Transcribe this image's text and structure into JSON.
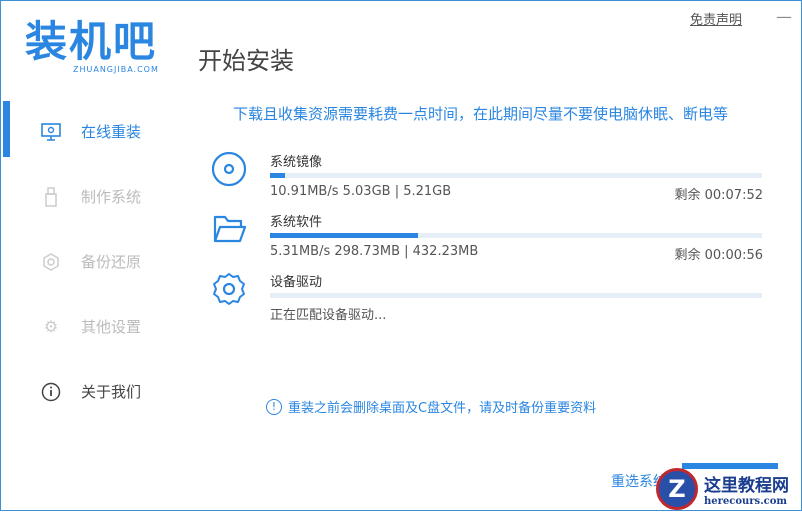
{
  "header": {
    "logo_text": "装机吧",
    "logo_sub": "ZHUANGJIBA.COM",
    "title": "开始安装",
    "disclaimer": "免责声明",
    "minimize": "—"
  },
  "sidebar": {
    "items": [
      {
        "label": "在线重装",
        "icon": "monitor-icon"
      },
      {
        "label": "制作系统",
        "icon": "usb-icon"
      },
      {
        "label": "备份还原",
        "icon": "backup-icon"
      },
      {
        "label": "其他设置",
        "icon": "gear-icon"
      },
      {
        "label": "关于我们",
        "icon": "info-icon"
      }
    ]
  },
  "main": {
    "notice": "下载且收集资源需要耗费一点时间，在此期间尽量不要使电脑休眠、断电等",
    "tasks": [
      {
        "name": "系统镜像",
        "info": "10.91MB/s 5.03GB | 5.21GB",
        "remain": "剩余 00:07:52",
        "progress": 3
      },
      {
        "name": "系统软件",
        "info": "5.31MB/s 298.73MB | 432.23MB",
        "remain": "剩余 00:00:56",
        "progress": 30
      },
      {
        "name": "设备驱动",
        "info": "正在匹配设备驱动...",
        "remain": "",
        "progress": 0
      }
    ],
    "warning": "重装之前会删除桌面及C盘文件，请及时备份重要资料",
    "warning_icon": "!",
    "reselect": "重选系统"
  },
  "watermark": {
    "logo": "Z",
    "title": "这里教程网",
    "url": "herecours.com"
  },
  "colors": {
    "accent": "#2a86e0"
  }
}
